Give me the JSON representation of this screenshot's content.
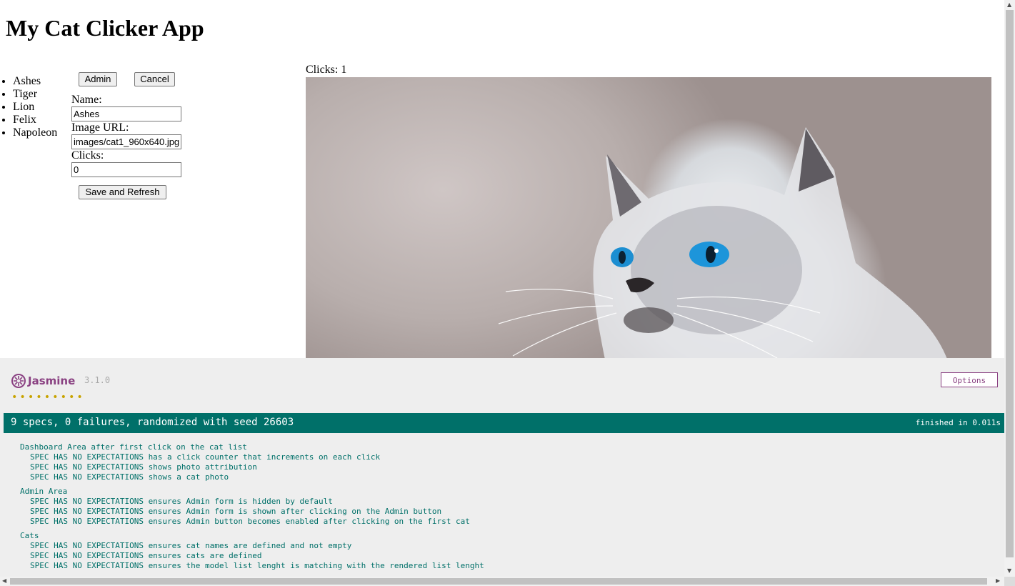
{
  "app": {
    "title": "My Cat Clicker App",
    "cats": [
      "Ashes",
      "Tiger",
      "Lion",
      "Felix",
      "Napoleon"
    ]
  },
  "admin": {
    "admin_button": "Admin",
    "cancel_button": "Cancel",
    "name_label": "Name:",
    "name_value": "Ashes",
    "image_url_label": "Image URL:",
    "image_url_value": "images/cat1_960x640.jpg",
    "clicks_label": "Clicks:",
    "clicks_value": "0",
    "save_button": "Save and Refresh"
  },
  "dashboard": {
    "clicks_text": "Clicks: 1",
    "photo_icon": "cat-photo"
  },
  "jasmine": {
    "logo_text": "Jasmine",
    "version": "3.1.0",
    "options_label": "Options",
    "dots": "•••••••••",
    "summary": "9 specs, 0 failures, randomized with seed 26603",
    "duration": "finished in 0.011s",
    "accent_color": "#8a4182",
    "pass_color": "#007069",
    "suites": [
      {
        "title": "Dashboard Area after first click on the cat list",
        "specs": [
          "SPEC HAS NO EXPECTATIONS has a click counter that increments on each click",
          "SPEC HAS NO EXPECTATIONS shows photo attribution",
          "SPEC HAS NO EXPECTATIONS shows a cat photo"
        ]
      },
      {
        "title": "Admin Area",
        "specs": [
          "SPEC HAS NO EXPECTATIONS ensures Admin form is hidden by default",
          "SPEC HAS NO EXPECTATIONS ensures Admin form is shown after clicking on the Admin button",
          "SPEC HAS NO EXPECTATIONS ensures Admin button becomes enabled after clicking on the first cat"
        ]
      },
      {
        "title": "Cats",
        "specs": [
          "SPEC HAS NO EXPECTATIONS ensures cat names are defined and not empty",
          "SPEC HAS NO EXPECTATIONS ensures cats are defined",
          "SPEC HAS NO EXPECTATIONS ensures the model list lenght is matching with the rendered list lenght"
        ]
      }
    ]
  }
}
